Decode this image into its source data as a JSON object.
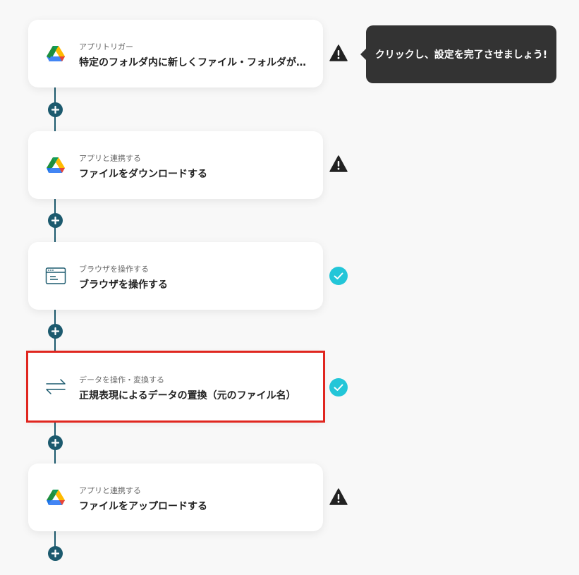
{
  "tooltip": {
    "text": "クリックし、設定を完了させましょう!"
  },
  "steps": [
    {
      "sub": "アプリトリガー",
      "title": "特定のフォルダ内に新しくファイル・フォルダが作成されたら",
      "icon": "google-drive-icon",
      "status": "warning",
      "selected": false
    },
    {
      "sub": "アプリと連携する",
      "title": "ファイルをダウンロードする",
      "icon": "google-drive-icon",
      "status": "warning",
      "selected": false
    },
    {
      "sub": "ブラウザを操作する",
      "title": "ブラウザを操作する",
      "icon": "browser-window-icon",
      "status": "complete",
      "selected": false
    },
    {
      "sub": "データを操作・変換する",
      "title": "正規表現によるデータの置換（元のファイル名）",
      "icon": "swap-arrows-icon",
      "status": "complete",
      "selected": true
    },
    {
      "sub": "アプリと連携する",
      "title": "ファイルをアップロードする",
      "icon": "google-drive-icon",
      "status": "warning",
      "selected": false
    }
  ],
  "colors": {
    "connector": "#1c5a6e",
    "complete": "#23c6d8",
    "warning": "#222222",
    "selection": "#e0261f",
    "tooltip_bg": "#333333"
  }
}
